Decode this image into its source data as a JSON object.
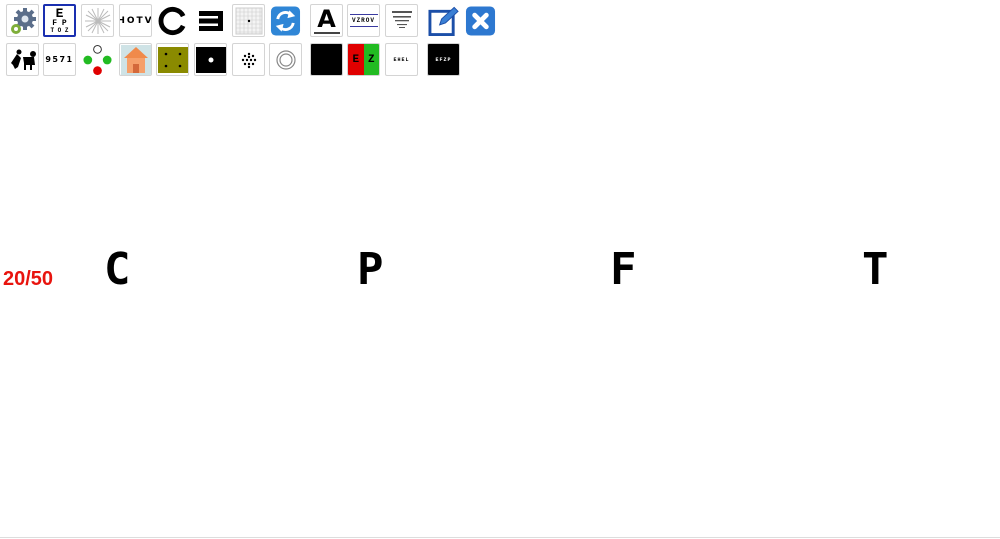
{
  "toolbar": {
    "row1": [
      {
        "name": "settings-button",
        "icon": "gear-icon"
      },
      {
        "name": "snellen-chart-button",
        "lines": [
          "E",
          "F P",
          "T O Z"
        ],
        "selected": true
      },
      {
        "name": "astigmatism-fan-button",
        "icon": "sunburst-icon"
      },
      {
        "name": "hotv-chart-button",
        "label": "HOTV"
      },
      {
        "name": "landolt-c-button",
        "icon": "landolt-c-icon"
      },
      {
        "name": "tumbling-e-button",
        "label": "E"
      },
      {
        "name": "amsler-grid-button",
        "icon": "grid-icon"
      },
      {
        "name": "refresh-button",
        "icon": "refresh-icon"
      },
      {
        "name": "single-letter-button",
        "label": "A"
      },
      {
        "name": "letter-line-button",
        "label": "VZROV"
      },
      {
        "name": "reading-chart-button",
        "icon": "reading-chart-icon"
      },
      {
        "name": "edit-button",
        "icon": "edit-icon"
      },
      {
        "name": "close-button",
        "icon": "close-icon"
      }
    ],
    "row2": [
      {
        "name": "pictures-chart-button",
        "icon": "animals-icon"
      },
      {
        "name": "numbers-chart-button",
        "label": "9571"
      },
      {
        "name": "worth-four-dot-button",
        "icon": "four-dot-icon"
      },
      {
        "name": "house-picture-button",
        "icon": "house-icon"
      },
      {
        "name": "olive-dots-button",
        "icon": "olive-dots-icon"
      },
      {
        "name": "fixation-dot-button",
        "icon": "dot-icon"
      },
      {
        "name": "dot-circle-button",
        "icon": "dot-cluster-icon"
      },
      {
        "name": "rings-button",
        "icon": "rings-icon"
      },
      {
        "name": "black-screen-button",
        "icon": "black-square-icon"
      },
      {
        "name": "red-green-button",
        "label_left": "E",
        "label_right": "Z"
      },
      {
        "name": "small-letters-button",
        "label": "EHEL"
      },
      {
        "name": "dark-letters-button",
        "label": "EFZP"
      }
    ]
  },
  "main": {
    "acuity_label": "20/50",
    "letters": [
      "C",
      "P",
      "F",
      "T"
    ]
  },
  "colors": {
    "acuity": "#e8140e",
    "selected_border": "#1a2fb0",
    "red": "#e00000",
    "green": "#22bb22",
    "olive": "#8a8a00"
  }
}
